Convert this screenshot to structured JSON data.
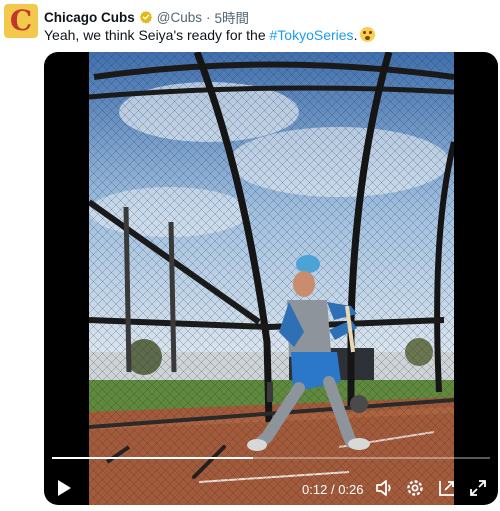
{
  "post": {
    "avatar_letter": "C",
    "display_name": "Chicago Cubs",
    "handle": "@Cubs",
    "separator": "·",
    "time": "5時間",
    "text_before": "Yeah, we think Seiya's ready for the ",
    "hashtag": "#TokyoSeries",
    "text_after": ".",
    "emoji": "flushed-face-emoji"
  },
  "video": {
    "current_time": "0:12",
    "time_divider": "/",
    "duration": "0:26",
    "progress_fraction": 0.46
  },
  "icons": {
    "verified": "verified-badge-icon",
    "play": "play-icon",
    "volume": "volume-icon",
    "settings": "gear-icon",
    "popout": "popout-icon",
    "fullscreen": "fullscreen-icon"
  },
  "colors": {
    "hashtag": "#1d9bf0",
    "verified_badge": "#e2b719",
    "avatar_bg": "#f2c94c",
    "avatar_letter": "#c0392b"
  }
}
